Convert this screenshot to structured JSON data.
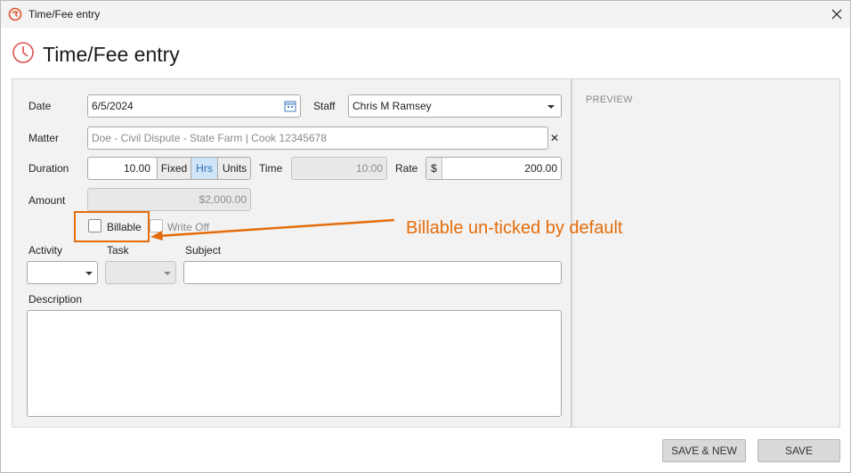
{
  "window": {
    "title": "Time/Fee entry",
    "app_icon": "app-logo-icon",
    "close_icon": "close-icon"
  },
  "header": {
    "title": "Time/Fee entry",
    "icon": "clock-icon",
    "accent": "#d9534f"
  },
  "form": {
    "date": {
      "label": "Date",
      "value": "6/5/2024",
      "icon": "calendar-icon"
    },
    "staff": {
      "label": "Staff",
      "value": "Chris M Ramsey"
    },
    "matter": {
      "label": "Matter",
      "value": "Doe - Civil Dispute - State Farm | Cook 12345678",
      "clear": "✕"
    },
    "duration": {
      "label": "Duration",
      "value": "10.00",
      "options": [
        "Fixed",
        "Hrs",
        "Units"
      ],
      "selected": "Hrs"
    },
    "time": {
      "label": "Time",
      "value": "10:00"
    },
    "rate": {
      "label": "Rate",
      "prefix": "$",
      "value": "200.00"
    },
    "amount": {
      "label": "Amount",
      "value": "$2,000.00"
    },
    "billable": {
      "label": "Billable",
      "checked": false
    },
    "write_off": {
      "label": "Write Off",
      "checked": false
    },
    "activity": {
      "label": "Activity",
      "value": ""
    },
    "task": {
      "label": "Task",
      "value": ""
    },
    "subject": {
      "label": "Subject",
      "value": ""
    },
    "description": {
      "label": "Description",
      "value": ""
    }
  },
  "preview": {
    "label": "PREVIEW"
  },
  "buttons": {
    "save_new": "SAVE & NEW",
    "save": "SAVE"
  },
  "annotation": {
    "text": "Billable un-ticked by default",
    "color": "#e46c0a"
  }
}
